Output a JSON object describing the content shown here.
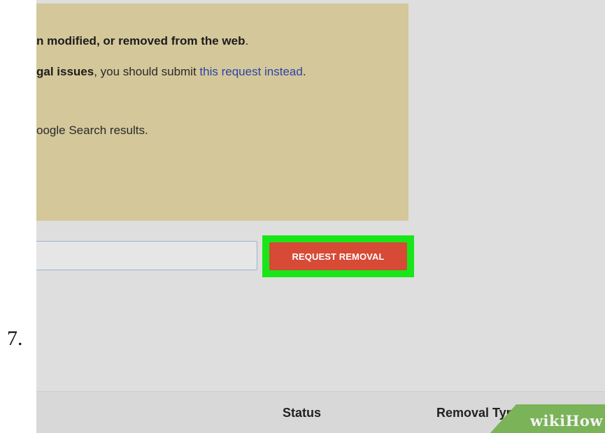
{
  "step": {
    "number": "7."
  },
  "info_panel": {
    "line1": {
      "bold": "n modified, or removed from the web",
      "after": "."
    },
    "line2": {
      "bold": "gal issues",
      "text": ", you should submit ",
      "link": "this request instead",
      "after": "."
    },
    "line3": {
      "text": "oogle Search results."
    }
  },
  "form": {
    "url_input_value": "",
    "request_button_label": "REQUEST REMOVAL"
  },
  "table": {
    "headers": {
      "status": "Status",
      "removal_type": "Removal Type"
    }
  },
  "watermark": {
    "text": "wikiHow"
  },
  "colors": {
    "panel": "#d4c79a",
    "button": "#d64a36",
    "highlight": "#19e619",
    "link": "#2b43a8"
  }
}
